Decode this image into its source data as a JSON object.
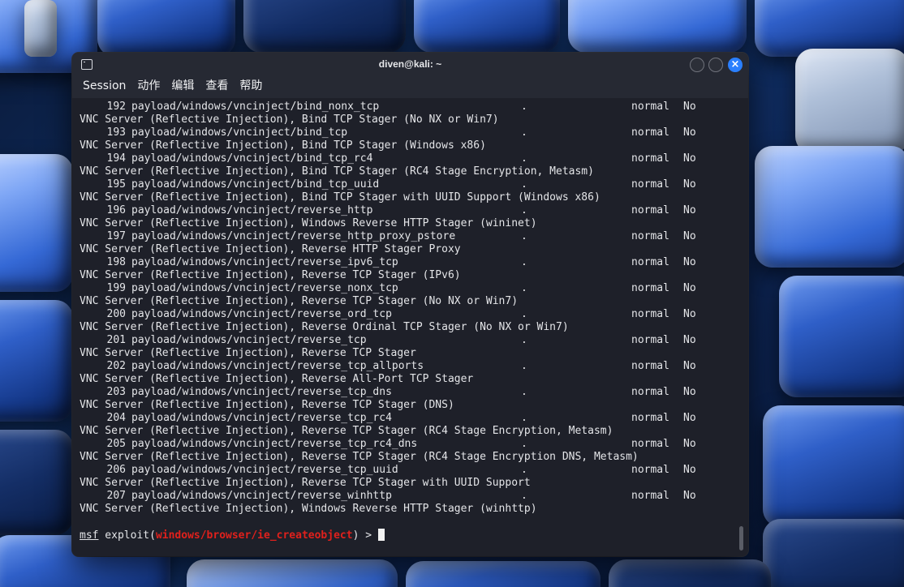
{
  "window": {
    "title": "diven@kali: ~",
    "close_glyph": "×"
  },
  "menu": [
    "Session",
    "动作",
    "编辑",
    "查看",
    "帮助"
  ],
  "rows": [
    {
      "num": "192",
      "name": "payload/windows/vncinject/bind_nonx_tcp",
      "date": ".",
      "rank": "normal",
      "check": "No",
      "desc": "VNC Server (Reflective Injection), Bind TCP Stager (No NX or Win7)"
    },
    {
      "num": "193",
      "name": "payload/windows/vncinject/bind_tcp",
      "date": ".",
      "rank": "normal",
      "check": "No",
      "desc": "VNC Server (Reflective Injection), Bind TCP Stager (Windows x86)"
    },
    {
      "num": "194",
      "name": "payload/windows/vncinject/bind_tcp_rc4",
      "date": ".",
      "rank": "normal",
      "check": "No",
      "desc": "VNC Server (Reflective Injection), Bind TCP Stager (RC4 Stage Encryption, Metasm)"
    },
    {
      "num": "195",
      "name": "payload/windows/vncinject/bind_tcp_uuid",
      "date": ".",
      "rank": "normal",
      "check": "No",
      "desc": "VNC Server (Reflective Injection), Bind TCP Stager with UUID Support (Windows x86)"
    },
    {
      "num": "196",
      "name": "payload/windows/vncinject/reverse_http",
      "date": ".",
      "rank": "normal",
      "check": "No",
      "desc": "VNC Server (Reflective Injection), Windows Reverse HTTP Stager (wininet)"
    },
    {
      "num": "197",
      "name": "payload/windows/vncinject/reverse_http_proxy_pstore",
      "date": ".",
      "rank": "normal",
      "check": "No",
      "desc": "VNC Server (Reflective Injection), Reverse HTTP Stager Proxy"
    },
    {
      "num": "198",
      "name": "payload/windows/vncinject/reverse_ipv6_tcp",
      "date": ".",
      "rank": "normal",
      "check": "No",
      "desc": "VNC Server (Reflective Injection), Reverse TCP Stager (IPv6)"
    },
    {
      "num": "199",
      "name": "payload/windows/vncinject/reverse_nonx_tcp",
      "date": ".",
      "rank": "normal",
      "check": "No",
      "desc": "VNC Server (Reflective Injection), Reverse TCP Stager (No NX or Win7)"
    },
    {
      "num": "200",
      "name": "payload/windows/vncinject/reverse_ord_tcp",
      "date": ".",
      "rank": "normal",
      "check": "No",
      "desc": "VNC Server (Reflective Injection), Reverse Ordinal TCP Stager (No NX or Win7)"
    },
    {
      "num": "201",
      "name": "payload/windows/vncinject/reverse_tcp",
      "date": ".",
      "rank": "normal",
      "check": "No",
      "desc": "VNC Server (Reflective Injection), Reverse TCP Stager"
    },
    {
      "num": "202",
      "name": "payload/windows/vncinject/reverse_tcp_allports",
      "date": ".",
      "rank": "normal",
      "check": "No",
      "desc": "VNC Server (Reflective Injection), Reverse All-Port TCP Stager"
    },
    {
      "num": "203",
      "name": "payload/windows/vncinject/reverse_tcp_dns",
      "date": ".",
      "rank": "normal",
      "check": "No",
      "desc": "VNC Server (Reflective Injection), Reverse TCP Stager (DNS)"
    },
    {
      "num": "204",
      "name": "payload/windows/vncinject/reverse_tcp_rc4",
      "date": ".",
      "rank": "normal",
      "check": "No",
      "desc": "VNC Server (Reflective Injection), Reverse TCP Stager (RC4 Stage Encryption, Metasm)"
    },
    {
      "num": "205",
      "name": "payload/windows/vncinject/reverse_tcp_rc4_dns",
      "date": ".",
      "rank": "normal",
      "check": "No",
      "desc": "VNC Server (Reflective Injection), Reverse TCP Stager (RC4 Stage Encryption DNS, Metasm)"
    },
    {
      "num": "206",
      "name": "payload/windows/vncinject/reverse_tcp_uuid",
      "date": ".",
      "rank": "normal",
      "check": "No",
      "desc": "VNC Server (Reflective Injection), Reverse TCP Stager with UUID Support"
    },
    {
      "num": "207",
      "name": "payload/windows/vncinject/reverse_winhttp",
      "date": ".",
      "rank": "normal",
      "check": "No",
      "desc": "VNC Server (Reflective Injection), Windows Reverse HTTP Stager (winhttp)"
    }
  ],
  "prompt": {
    "prefix": "msf",
    "command": " exploit(",
    "module": "windows/browser/ie_createobject",
    "suffix": ") > "
  },
  "colors": {
    "module_red": "#e0201c",
    "close_button_blue": "#2a7fff",
    "terminal_bg": "#1e2029"
  },
  "icons": [
    "terminal-app-icon",
    "minimize-icon",
    "maximize-icon",
    "close-icon"
  ]
}
